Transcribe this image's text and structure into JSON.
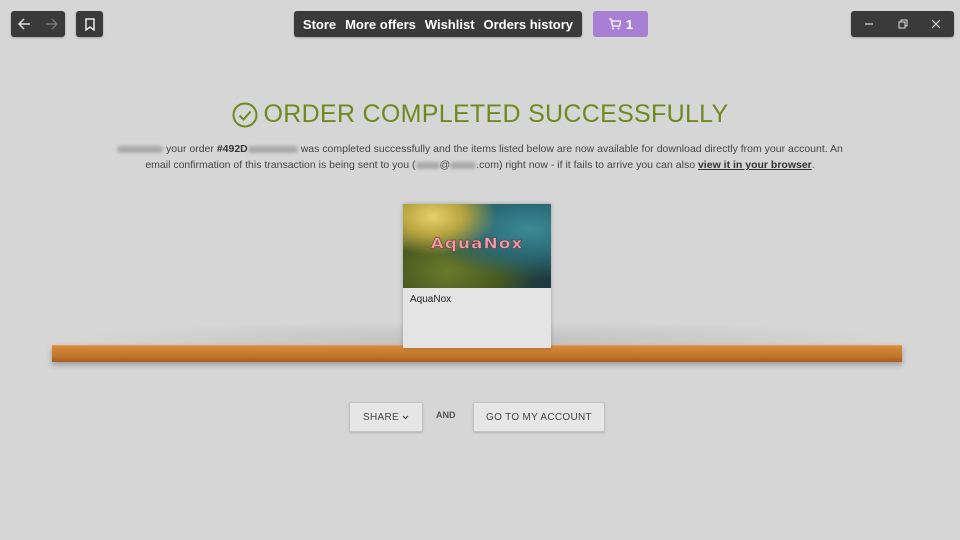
{
  "toolbar": {
    "back_icon": "arrow-left-icon",
    "forward_icon": "arrow-right-icon",
    "bookmark_icon": "bookmark-icon",
    "menu": [
      {
        "label": "Store"
      },
      {
        "label": "More offers"
      },
      {
        "label": "Wishlist"
      },
      {
        "label": "Orders history"
      }
    ],
    "cart_count": "1",
    "cart_icon": "cart-icon",
    "window_controls": [
      "minimize-icon",
      "restore-icon",
      "close-icon"
    ]
  },
  "heading": {
    "text": "ORDER COMPLETED SUCCESSFULLY",
    "icon": "check-circle-icon",
    "color": "#6e8a1e"
  },
  "message": {
    "part1": "your order",
    "order_prefix": "#492D",
    "part2": "was completed successfully and the items listed below are now available for download directly from your account. An email confirmation of this transaction is being sent to you (",
    "email_at": "@",
    "email_suffix": ".com) right now - if it fails to arrive you can also",
    "link": "view it in your browser",
    "end": "."
  },
  "product": {
    "title": "AquaNox",
    "logo_text": "AquaNox"
  },
  "actions": {
    "share": "SHARE",
    "and": "AND",
    "account": "GO TO MY ACCOUNT"
  },
  "colors": {
    "accent": "#a97fd6",
    "success": "#6e8a1e",
    "shelf": "#c4762c"
  }
}
